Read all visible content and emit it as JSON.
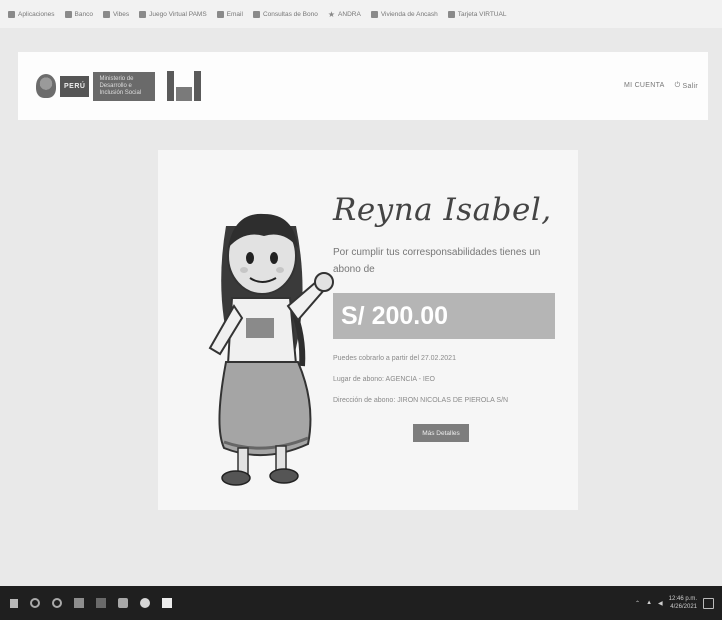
{
  "bookmarks": [
    {
      "label": "Aplicaciones"
    },
    {
      "label": "Banco"
    },
    {
      "label": "Vibes"
    },
    {
      "label": "Juego Virtual PAMS"
    },
    {
      "label": "Email"
    },
    {
      "label": "Consultas de Bono"
    },
    {
      "label": "ANDRA"
    },
    {
      "label": "Vivienda de Ancash"
    },
    {
      "label": "Tarjeta VIRTUAL"
    }
  ],
  "header": {
    "peru_label": "PERÚ",
    "ministry_label": "Ministerio de Desarrollo e Inclusión Social",
    "nav_points": "MI CUENTA",
    "nav_exit": "Salir"
  },
  "card": {
    "greeting": "Reyna Isabel,",
    "message": "Por cumplir tus corresponsabilidades tienes un abono de",
    "amount": "S/ 200.00",
    "info": [
      "Puedes cobrarlo a partir del 27.02.2021",
      "Lugar de abono: AGENCIA - IEO",
      "Dirección de abono: JIRON NICOLAS DE PIEROLA S/N"
    ],
    "button_label": "Más Detalles"
  },
  "taskbar": {
    "time": "12:46 p.m.",
    "date": "4/26/2021"
  }
}
